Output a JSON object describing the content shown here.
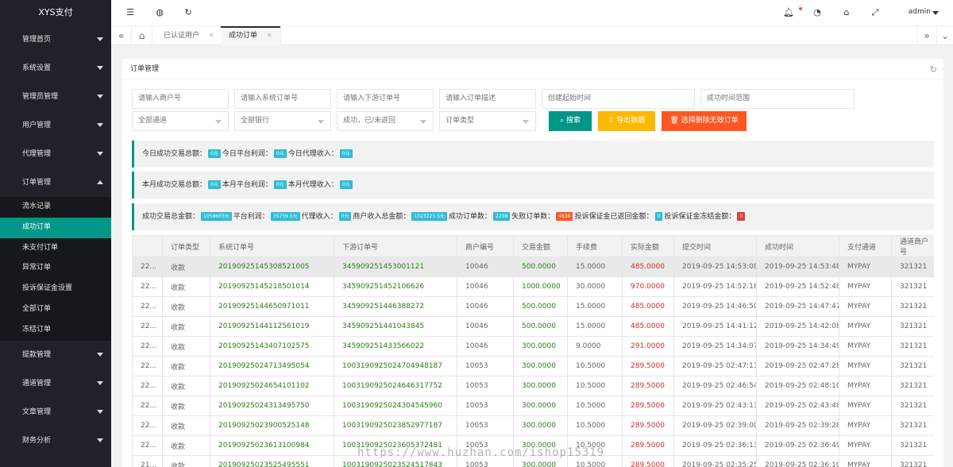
{
  "app": {
    "title": "XYS支付"
  },
  "sidebar": {
    "items": [
      {
        "label": "管理首页"
      },
      {
        "label": "系统设置"
      },
      {
        "label": "管理员管理"
      },
      {
        "label": "用户管理"
      },
      {
        "label": "代理管理"
      },
      {
        "label": "订单管理"
      },
      {
        "label": "提款管理"
      },
      {
        "label": "通道管理"
      },
      {
        "label": "文章管理"
      },
      {
        "label": "财务分析"
      }
    ],
    "sub_items": [
      {
        "label": "流水记录"
      },
      {
        "label": "成功订单"
      },
      {
        "label": "未支付订单"
      },
      {
        "label": "异常订单"
      },
      {
        "label": "投诉保证金设置"
      },
      {
        "label": "全部订单"
      },
      {
        "label": "冻结订单"
      }
    ]
  },
  "header": {
    "user": "admin"
  },
  "tabs": [
    {
      "label": "已认证用户"
    },
    {
      "label": "成功订单"
    }
  ],
  "card": {
    "title": "订单管理"
  },
  "filters": {
    "merchant_no": "请输入商户号",
    "system_order_no": "请输入系统订单号",
    "downstream_order_no": "请输入下游订单号",
    "order_desc": "请输入订单描述",
    "create_start": "创建起始时间",
    "success_time_range": "成功时间范围",
    "channel": "全部通道",
    "bank": "全部银行",
    "status": "成功，已/未返回",
    "order_type": "订单类型"
  },
  "buttons": {
    "search": "搜索",
    "export": "导出数据",
    "delete_invalid": "选择删除无效订单"
  },
  "stats": {
    "today": {
      "label1": "今日成功交易总额：",
      "value1": "0元",
      "label2": "今日平台利润：",
      "value2": "0元",
      "label3": "今日代理收入：",
      "value3": "0元"
    },
    "month": {
      "label1": "本月成功交易总额：",
      "value1": "0元",
      "label2": "本月平台利润：",
      "value2": "0元",
      "label3": "本月代理收入：",
      "value3": "0元"
    },
    "total": {
      "label1": "成功交易总金额：",
      "value1": "1058603元",
      "label2": "平台利润：",
      "value2": "35759.5元",
      "label3": "代理收入：",
      "value3": "0元",
      "label4": "商户收入总金额：",
      "value4": "1023223.5元",
      "label5": "成功订单数：",
      "value5": "2208",
      "label6": "失败订单数：",
      "value6": "4638",
      "label7": "投诉保证金已返回金额：",
      "value7": "0",
      "label8": "投诉保证金冻结金额：",
      "value8": "0"
    }
  },
  "table": {
    "headers": [
      "",
      "订单类型",
      "系统订单号",
      "下游订单号",
      "商户编号",
      "交易金额",
      "手续费",
      "实际金额",
      "提交时间",
      "成功时间",
      "支付通道",
      "通道商户号"
    ],
    "rows": [
      [
        "22...",
        "收款",
        "20190925145308521005",
        "345909251453001121",
        "10046",
        "500.0000",
        "15.0000",
        "485.0000",
        "2019-09-25 14:53:08",
        "2019-09-25 14:53:48",
        "MYPAY",
        "321321"
      ],
      [
        "22...",
        "收款",
        "20190925145218501014",
        "345909251452106626",
        "10046",
        "1000.0000",
        "30.0000",
        "970.0000",
        "2019-09-25 14:52:18",
        "2019-09-25 14:52:48",
        "MYPAY",
        "321321"
      ],
      [
        "22...",
        "收款",
        "20190925144650971011",
        "345909251446388272",
        "10046",
        "500.0000",
        "15.0000",
        "485.0000",
        "2019-09-25 14:46:50",
        "2019-09-25 14:47:47",
        "MYPAY",
        "321321"
      ],
      [
        "22...",
        "收款",
        "20190925144112561019",
        "345909251441043845",
        "10046",
        "500.0000",
        "15.0000",
        "485.0000",
        "2019-09-25 14:41:12",
        "2019-09-25 14:42:08",
        "MYPAY",
        "321321"
      ],
      [
        "22...",
        "收款",
        "20190925143407102575",
        "345909251433566022",
        "10046",
        "300.0000",
        "9.0000",
        "291.0000",
        "2019-09-25 14:34:07",
        "2019-09-25 14:34:49",
        "MYPAY",
        "321321"
      ],
      [
        "22...",
        "收款",
        "20190925024713495054",
        "100319092502470494818​7",
        "10053",
        "300.0000",
        "10.5000",
        "289.5000",
        "2019-09-25 02:47:13",
        "2019-09-25 02:47:28",
        "MYPAY",
        "321321"
      ],
      [
        "22...",
        "收款",
        "20190925024654101102",
        "100319092502464631775​2",
        "10053",
        "300.0000",
        "10.5000",
        "289.5000",
        "2019-09-25 02:46:54",
        "2019-09-25 02:48:10",
        "MYPAY",
        "321321"
      ],
      [
        "22...",
        "收款",
        "20190925024313495750",
        "100319092502430454596​0",
        "10053",
        "300.0000",
        "10.5000",
        "289.5000",
        "2019-09-25 02:43:13",
        "2019-09-25 02:43:48",
        "MYPAY",
        "321321"
      ],
      [
        "22...",
        "收款",
        "20190925023900525148",
        "100319092502385297718​7",
        "10053",
        "300.0000",
        "10.5000",
        "289.5000",
        "2019-09-25 02:39:00",
        "2019-09-25 02:39:28",
        "MYPAY",
        "321321"
      ],
      [
        "22...",
        "收款",
        "20190925023613100984",
        "100319092502360537248​1",
        "10053",
        "300.0000",
        "10.5000",
        "289.5000",
        "2019-09-25 02:36:13",
        "2019-09-25 02:36:49",
        "MYPAY",
        "321321"
      ],
      [
        "21...",
        "收款",
        "20190925023525495551",
        "100319092502352451784​3",
        "10053",
        "300.0000",
        "10.5000",
        "289.5000",
        "2019-09-25 02:35:25",
        "2019-09-25 02:36:10",
        "MYPAY",
        "321321"
      ]
    ]
  },
  "watermark": "https://www.huzhan.com/ishop15319"
}
